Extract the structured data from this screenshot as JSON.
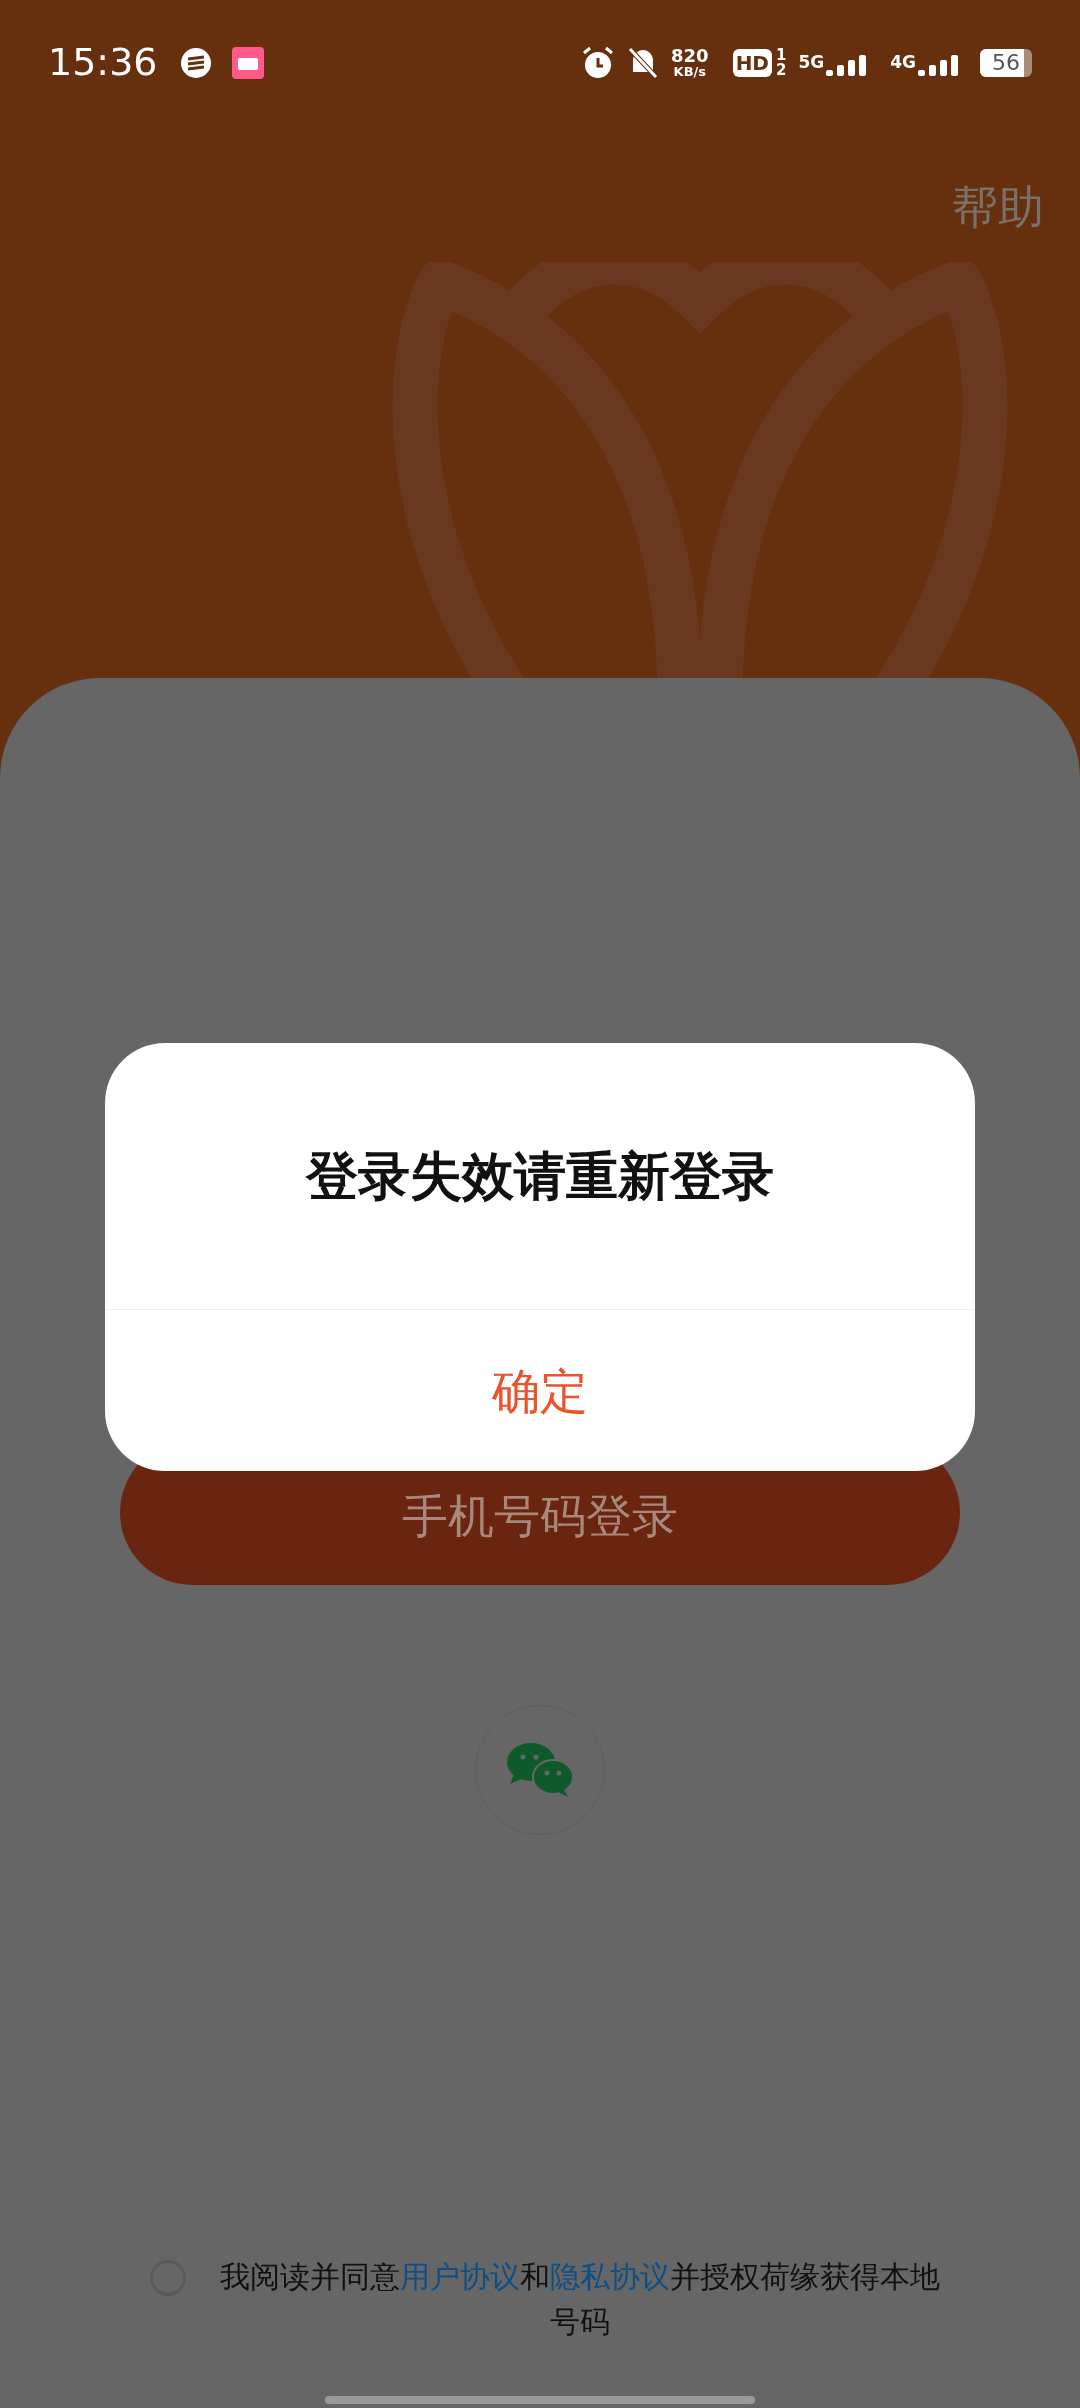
{
  "status_bar": {
    "time": "15:36",
    "net_speed": "820",
    "net_unit": "KB/s",
    "hd": "HD",
    "sim_1": "1",
    "sim_2": "2",
    "network_1": "5G",
    "network_2": "4G",
    "battery": "56"
  },
  "header": {
    "help": "帮助"
  },
  "login": {
    "phone_login": "手机号码登录"
  },
  "agreement": {
    "checked": false,
    "parts": [
      {
        "kind": "text",
        "text": "我阅读并同意"
      },
      {
        "kind": "link",
        "text": "用户协议"
      },
      {
        "kind": "text",
        "text": "和"
      },
      {
        "kind": "link",
        "text": "隐私协议"
      },
      {
        "kind": "text",
        "text": "并授权荷缘获得本地号码"
      }
    ]
  },
  "dialog": {
    "title": "登录失效请重新登录",
    "confirm": "确定"
  }
}
